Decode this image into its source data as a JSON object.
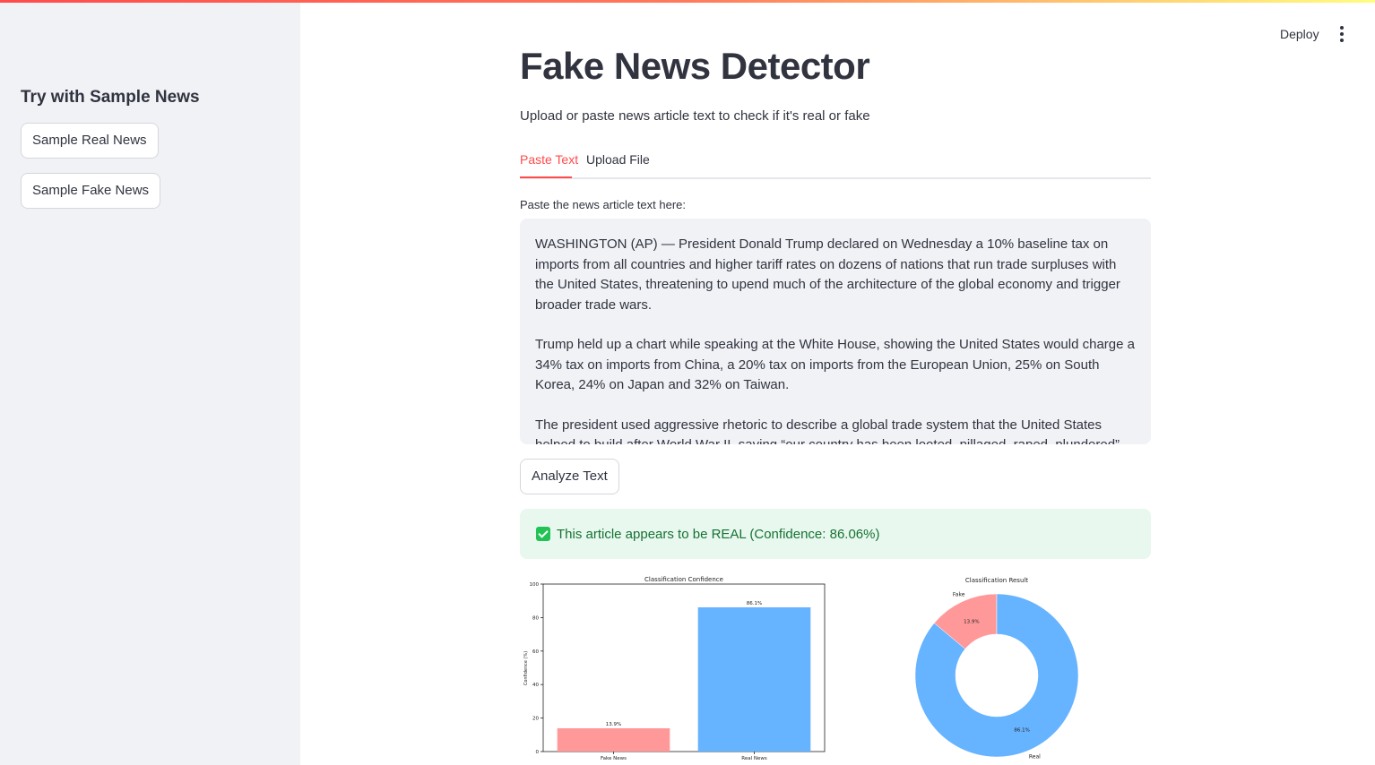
{
  "sidebar": {
    "heading": "Try with Sample News",
    "buttons": [
      "Sample Real News",
      "Sample Fake News"
    ]
  },
  "header": {
    "deploy_label": "Deploy",
    "menu_icon": "kebab-menu-icon"
  },
  "main": {
    "title": "Fake News Detector",
    "subtitle": "Upload or paste news article text to check if it's real or fake",
    "tabs": [
      {
        "label": "Paste Text",
        "active": true
      },
      {
        "label": "Upload File",
        "active": false
      }
    ],
    "textarea_label": "Paste the news article text here:",
    "article_paragraphs": [
      "WASHINGTON (AP) — President Donald Trump declared on Wednesday a 10% baseline tax on imports from all countries and higher tariff rates on dozens of nations that run trade surpluses with the United States, threatening to upend much of the architecture of the global economy and trigger broader trade wars.",
      "Trump held up a chart while speaking at the White House, showing the United States would charge a 34% tax on imports from China, a 20% tax on imports from the European Union, 25% on South Korea, 24% on Japan and 32% on Taiwan.",
      "The president used aggressive rhetoric to describe a global trade system that the United States helped to build after World War II, saying “our country has been looted, pillaged, raped, plundered”"
    ],
    "analyze_label": "Analyze Text",
    "result_text": "This article appears to be REAL (Confidence: 86.06%)",
    "result_color": "#177233",
    "accent_color": "#ff4b4b"
  },
  "chart_data": [
    {
      "type": "bar",
      "title": "Classification Confidence",
      "ylabel": "Confidence (%)",
      "categories": [
        "Fake News",
        "Real News"
      ],
      "values": [
        13.9,
        86.1
      ],
      "value_labels": [
        "13.9%",
        "86.1%"
      ],
      "colors": [
        "#ff9999",
        "#66b3ff"
      ],
      "ylim": [
        0,
        100
      ],
      "yticks": [
        0,
        20,
        40,
        60,
        80,
        100
      ]
    },
    {
      "type": "pie",
      "title": "Classification Result",
      "labels": [
        "Fake",
        "Real"
      ],
      "values": [
        13.9,
        86.1
      ],
      "value_labels": [
        "13.9%",
        "86.1%"
      ],
      "colors": [
        "#ff9999",
        "#66b3ff"
      ],
      "donut": true
    }
  ]
}
